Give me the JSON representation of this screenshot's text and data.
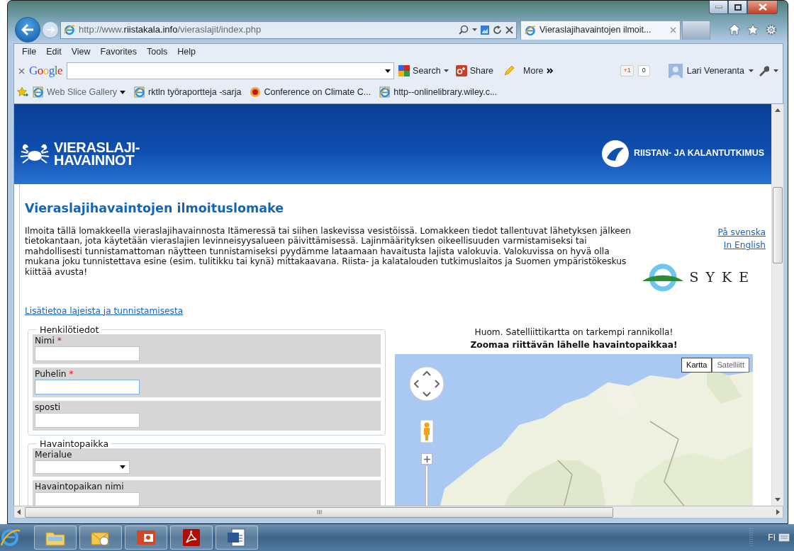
{
  "window": {
    "tabs": [
      {
        "label": "Vieraslajihavaintojen ilmoit...",
        "selected": true
      }
    ]
  },
  "address_bar": {
    "scheme": "http://www.",
    "domain": "riistakala.info",
    "path": "/vieraslajit/index.php"
  },
  "menu": [
    "File",
    "Edit",
    "View",
    "Favorites",
    "Tools",
    "Help"
  ],
  "google_toolbar": {
    "logo": "Google",
    "search": "Search",
    "share": "Share",
    "more": "More",
    "plus_one": "+1",
    "plus_one_count": "0",
    "user": "Lari Veneranta"
  },
  "favorites": [
    {
      "label": "Web Slice Gallery",
      "kind": "gallery"
    },
    {
      "label": "rktln työraportteja -sarja",
      "kind": "page"
    },
    {
      "label": "Conference on Climate C...",
      "kind": "conference"
    },
    {
      "label": "http--onlinelibrary.wiley.c...",
      "kind": "page"
    }
  ],
  "page": {
    "header_title": [
      "VIERASLAJI-",
      "HAVAINNOT"
    ],
    "header_org": "RIISTAN- JA KALANTUTKIMUS",
    "title": "Vieraslajihavaintojen ilmoituslomake",
    "intro": "Ilmoita tällä lomakkeella vieraslajihavainnosta Itämeressä tai siihen laskevissa vesistöissä. Lomakkeen tiedot tallentuvat lähetyksen jälkeen tietokantaan, jota käytetään vieraslajien levinneisyysalueen päivittämisessä. Lajinmäärityksen oikeellisuuden varmistamiseksi tai mahdollisesti tunnistamattoman näytteen tunnistamiseksi pyydämme lataamaan havaitusta lajista valokuvia. Valokuvissa on hyvä olla mukana joku tunnistettava esine (esim. tulitikku tai kynä) mittakaavana. Riista- ja kalatalouden tutkimuslaitos ja Suomen ympäristökeskus kiittää avusta!",
    "language_links": [
      "På svenska",
      "In English"
    ],
    "partner_logo": "SYKE",
    "info_link": "Lisätietoa lajeista ja tunnistamisesta",
    "fieldsets": [
      {
        "legend": "Henkilötiedot",
        "fields": [
          {
            "label": "Nimi",
            "required_mark": "*",
            "kind": "text",
            "focused": false
          },
          {
            "label": "Puhelin",
            "required_mark": "*",
            "kind": "text",
            "focused": true
          },
          {
            "label": "sposti",
            "kind": "text",
            "focused": false
          }
        ]
      },
      {
        "legend": "Havaintopaikka",
        "fields": [
          {
            "label": "Merialue",
            "kind": "select",
            "focused": false
          },
          {
            "label": "Havaintopaikan nimi",
            "kind": "text",
            "focused": false
          }
        ]
      }
    ],
    "map": {
      "note": "Huom. Satelliittikartta on tarkempi rannikolla!",
      "note_bold": "Zoomaa riittävän lähelle havaintopaikkaa!",
      "map_types": [
        {
          "label": "Kartta",
          "selected": true
        },
        {
          "label": "Satelliitt",
          "selected": false
        }
      ]
    }
  },
  "taskbar": {
    "apps": [
      {
        "kind": "browser"
      },
      {
        "kind": "folder"
      },
      {
        "kind": "mail"
      },
      {
        "kind": "slides"
      },
      {
        "kind": "pdf"
      },
      {
        "kind": "document"
      }
    ],
    "language": "FI"
  }
}
